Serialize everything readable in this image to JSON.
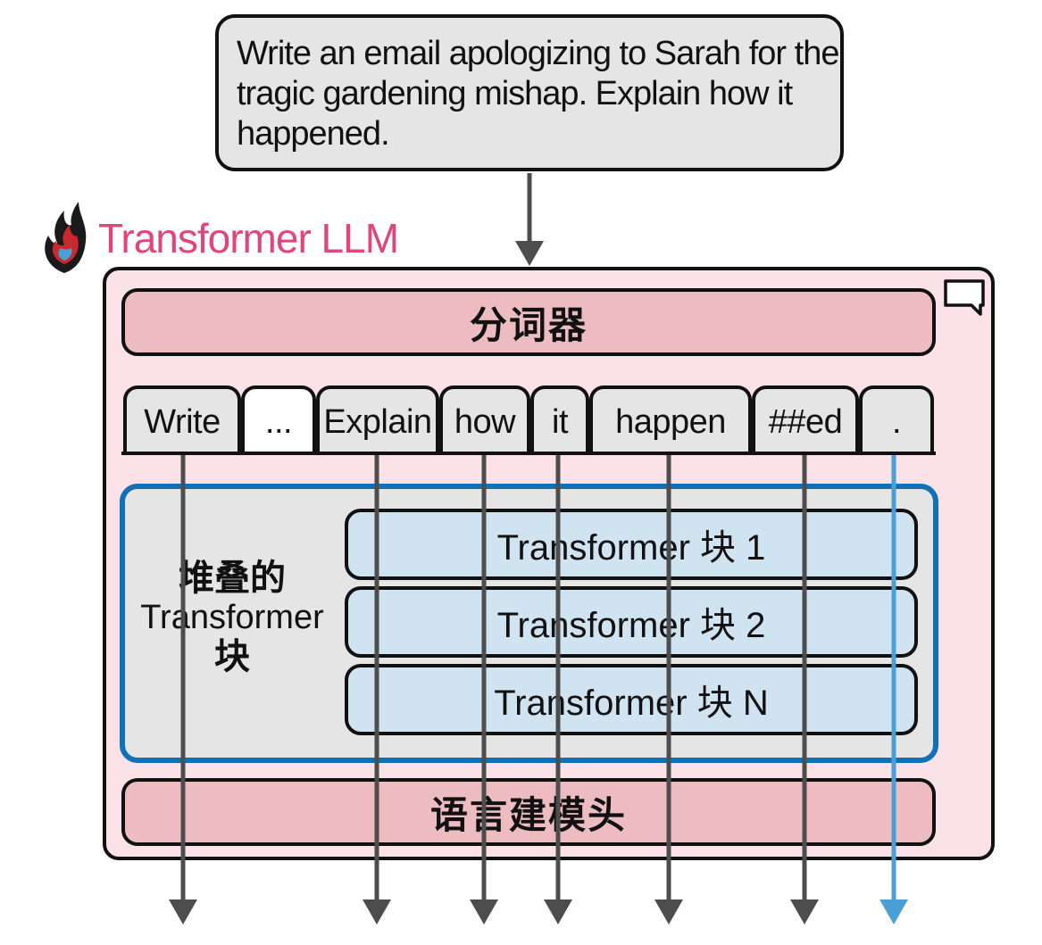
{
  "prompt": {
    "lines": [
      "Write an email apologizing to Sarah for the",
      "tragic gardening mishap. Explain how it",
      "happened."
    ]
  },
  "brand": {
    "label": "Transformer LLM",
    "color": "#e0457b"
  },
  "tokenizer": {
    "label": "分词器"
  },
  "tokens": [
    "Write",
    "...",
    "Explain",
    "how",
    "it",
    "happen",
    "##ed",
    "."
  ],
  "stack": {
    "label_cn_top": "堆叠的",
    "label_en": "Transformer",
    "label_cn_bottom": "块",
    "blocks": [
      "Transformer 块 1",
      "Transformer 块 2",
      "Transformer 块 N"
    ]
  },
  "lm_head": {
    "label": "语言建模头"
  },
  "colors": {
    "llm_background": "#fbe1e8",
    "bar_fill": "#ecbcc0",
    "block_fill": "#cfe3f1",
    "stack_border": "#1070b8",
    "token_fill": "#e5e5e5",
    "arrow": "#4d4d4d",
    "highlight_arrow": "#4a9fd5"
  }
}
